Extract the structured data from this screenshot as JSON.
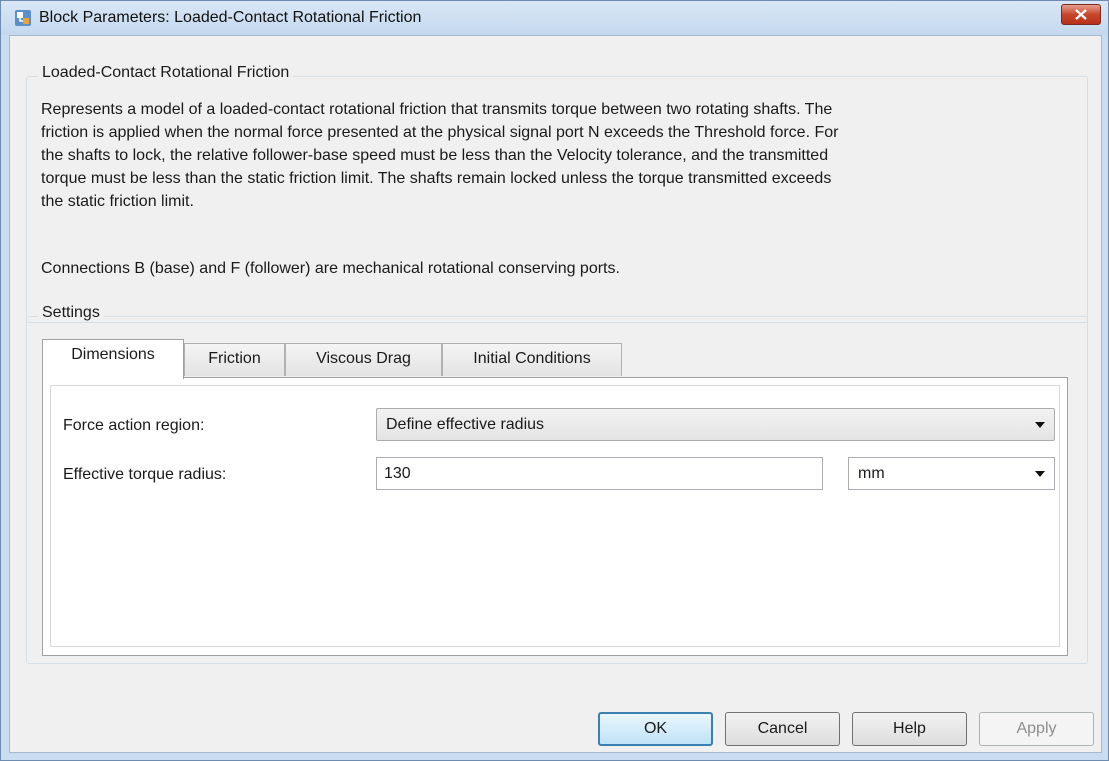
{
  "window": {
    "title": "Block Parameters: Loaded-Contact Rotational Friction"
  },
  "description": {
    "group_title": "Loaded-Contact Rotational Friction",
    "lines": [
      "Represents a model of a loaded-contact rotational friction that transmits torque between two rotating shafts. The",
      "friction is applied when the normal force presented at the physical signal port N exceeds the Threshold force. For",
      "the shafts to lock, the relative follower-base speed must be less than the Velocity tolerance, and the transmitted",
      "torque must be less than the static friction limit. The shafts remain locked unless the torque transmitted exceeds",
      "the static friction limit."
    ],
    "connections": "Connections B (base) and F (follower) are mechanical rotational conserving ports."
  },
  "settings": {
    "group_title": "Settings",
    "tabs": [
      {
        "label": "Dimensions",
        "active": true
      },
      {
        "label": "Friction",
        "active": false
      },
      {
        "label": "Viscous Drag",
        "active": false
      },
      {
        "label": "Initial Conditions",
        "active": false
      }
    ],
    "force_action_region": {
      "label": "Force action region:",
      "value": "Define effective radius"
    },
    "effective_torque_radius": {
      "label": "Effective torque radius:",
      "value": "130",
      "unit": "mm"
    }
  },
  "buttons": {
    "ok": "OK",
    "cancel": "Cancel",
    "help": "Help",
    "apply": "Apply"
  },
  "icons": {
    "app": "simulink-block-icon",
    "close": "close-icon",
    "dropdown": "chevron-down-icon"
  },
  "colors": {
    "close_button": "#c7462b",
    "default_button_border": "#3c7fb1"
  }
}
